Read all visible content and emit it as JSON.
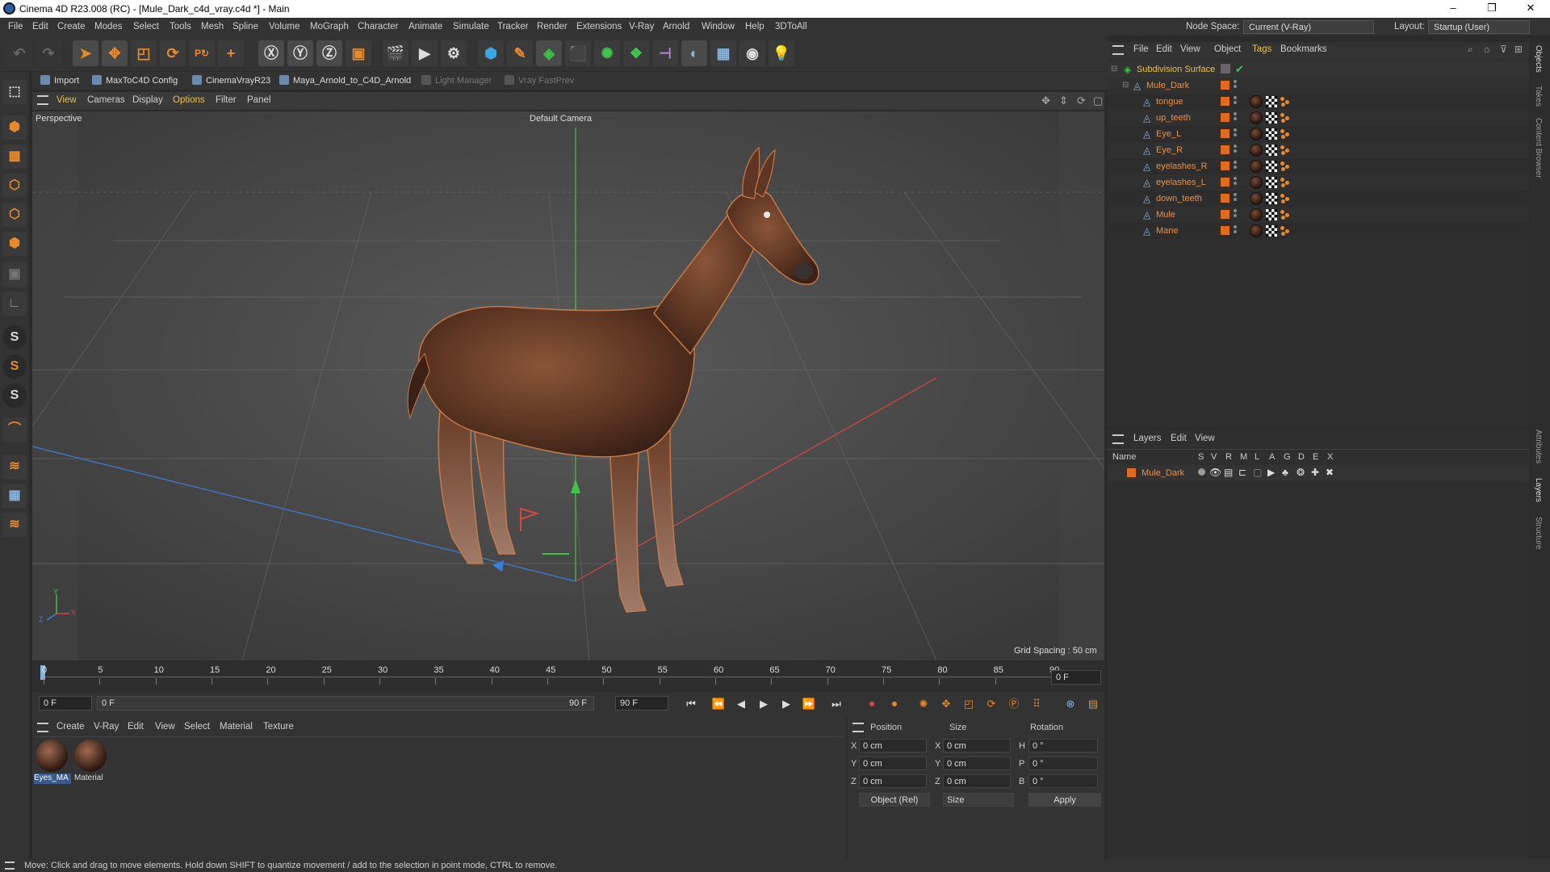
{
  "window": {
    "title": "Cinema 4D R23.008 (RC) - [Mule_Dark_c4d_vray.c4d *] - Main",
    "controls": [
      "–",
      "❐",
      "✕"
    ]
  },
  "menubar": {
    "items": [
      "File",
      "Edit",
      "Create",
      "Modes",
      "Select",
      "Tools",
      "Mesh",
      "Spline",
      "Volume",
      "MoGraph",
      "Character",
      "Animate",
      "Simulate",
      "Tracker",
      "Render",
      "Extensions",
      "V-Ray",
      "Arnold",
      "Window",
      "Help",
      "3DToAll"
    ],
    "node_space_label": "Node Space:",
    "node_space_value": "Current (V-Ray)",
    "layout_label": "Layout:",
    "layout_value": "Startup (User)"
  },
  "plugins": {
    "items": [
      "Import",
      "MaxToC4D Config",
      "CinemaVrayR23",
      "Maya_Arnold_to_C4D_Arnold",
      "Light Manager",
      "Vray FastPrev"
    ]
  },
  "viewport": {
    "menu": [
      "View",
      "Cameras",
      "Display",
      "Options",
      "Filter",
      "Panel"
    ],
    "view_name": "Perspective",
    "camera": "Default Camera",
    "grid_spacing": "Grid Spacing : 50 cm",
    "axis_labels": [
      "Y",
      "Z",
      "X"
    ]
  },
  "timeline": {
    "ticks": [
      "0",
      "5",
      "10",
      "15",
      "20",
      "25",
      "30",
      "35",
      "40",
      "45",
      "50",
      "55",
      "60",
      "65",
      "70",
      "75",
      "80",
      "85",
      "90"
    ],
    "end_frame_box": "0 F",
    "current_frame": "0 F",
    "range_start": "0 F",
    "range_end": "90 F",
    "max_frame": "90 F"
  },
  "material_manager": {
    "menu": [
      "Create",
      "V-Ray",
      "Edit",
      "View",
      "Select",
      "Material",
      "Texture"
    ],
    "materials": [
      {
        "name": "Eyes_MA"
      },
      {
        "name": "Material"
      }
    ]
  },
  "coordinates": {
    "headers": [
      "Position",
      "Size",
      "Rotation"
    ],
    "rows": [
      {
        "axis": "X",
        "pos": "0 cm",
        "size_axis": "X",
        "size": "0 cm",
        "rot_axis": "H",
        "rot": "0 °"
      },
      {
        "axis": "Y",
        "pos": "0 cm",
        "size_axis": "Y",
        "size": "0 cm",
        "rot_axis": "P",
        "rot": "0 °"
      },
      {
        "axis": "Z",
        "pos": "0 cm",
        "size_axis": "Z",
        "size": "0 cm",
        "rot_axis": "B",
        "rot": "0 °"
      }
    ],
    "mode_select": "Object (Rel)",
    "size_select": "Size",
    "apply_label": "Apply"
  },
  "object_manager": {
    "menu": [
      "File",
      "Edit",
      "View",
      "Object",
      "Tags",
      "Bookmarks"
    ],
    "root": "Subdivision Surface",
    "group": "Mule_Dark",
    "objects": [
      "tongue",
      "up_teeth",
      "Eye_L",
      "Eye_R",
      "eyelashes_R",
      "eyelashes_L",
      "down_teeth",
      "Mule",
      "Mane"
    ]
  },
  "layer_manager": {
    "menu": [
      "Layers",
      "Edit",
      "View"
    ],
    "columns": [
      "Name",
      "S",
      "V",
      "R",
      "M",
      "L",
      "A",
      "G",
      "D",
      "E",
      "X"
    ],
    "layers": [
      {
        "name": "Mule_Dark"
      }
    ]
  },
  "right_tabs": [
    "Objects",
    "Takes",
    "Content Browser",
    "Attributes",
    "Layers",
    "Structure"
  ],
  "status": {
    "text": "Move: Click and drag to move elements. Hold down SHIFT to quantize movement / add to the selection in point mode, CTRL to remove."
  },
  "colors": {
    "accent": "#e8914a",
    "layer_color": "#e06b1c",
    "x_axis": "#d9463d",
    "y_axis": "#3fc64a",
    "z_axis": "#3a7fd9"
  }
}
